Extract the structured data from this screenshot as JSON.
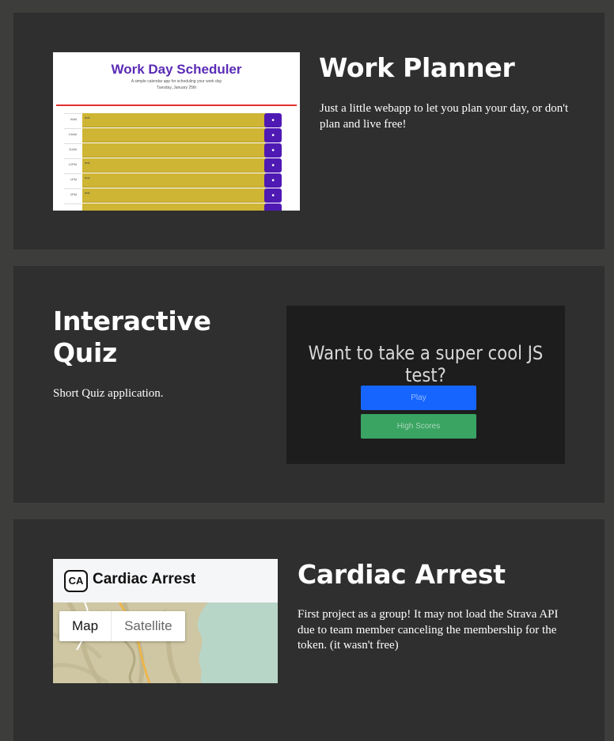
{
  "projects": [
    {
      "title": "Work Planner",
      "description": "Just a little webapp to let you plan your day, or don't plan and live free!",
      "thumbnail": {
        "app_title": "Work Day Scheduler",
        "subtitle": "A simple calendar app for scheduling your work day",
        "date": "Tuesday, January 25th",
        "hours": [
          "9AM",
          "10AM",
          "11AM",
          "12PM",
          "1PM",
          "2PM"
        ],
        "entries": [
          "test",
          "",
          "",
          "test",
          "test",
          "test"
        ]
      }
    },
    {
      "title": "Interactive Quiz",
      "description": "Short Quiz application.",
      "thumbnail": {
        "question": "Want to take a super cool JS test?",
        "play_label": "Play",
        "scores_label": "High Scores"
      }
    },
    {
      "title": "Cardiac Arrest",
      "description": "First project as a group! It may not load the Strava API due to team member canceling the membership for the token. (it wasn't free)",
      "thumbnail": {
        "logo_text": "CA",
        "app_name": "Cardiac Arrest",
        "map_label": "Map",
        "satellite_label": "Satellite"
      }
    }
  ],
  "colors": {
    "page_background": "#3d3e3c",
    "card_background": "#2e2f2e",
    "scheduler_accent": "#5b2bb5",
    "scheduler_slot": "#cfb534",
    "quiz_play": "#1665ff",
    "quiz_scores": "#3aa463"
  }
}
